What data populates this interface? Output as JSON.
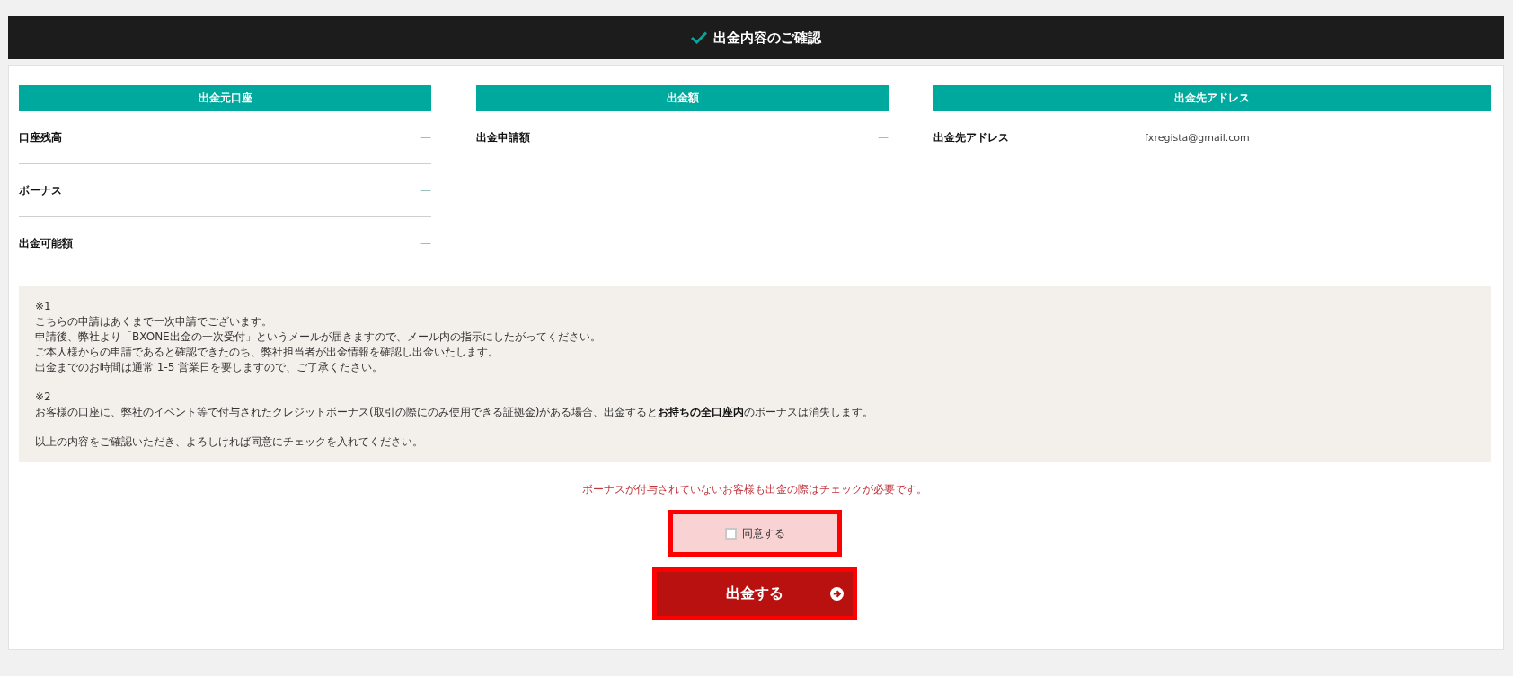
{
  "header": {
    "title": "出金内容のご確認"
  },
  "sections": [
    {
      "title": "出金元口座",
      "rows": [
        {
          "label": "口座残高",
          "value": "—",
          "kind": "dash"
        },
        {
          "label": "ボーナス",
          "value": "—",
          "kind": "dash"
        },
        {
          "label": "出金可能額",
          "value": "—",
          "kind": "dash"
        }
      ]
    },
    {
      "title": "出金額",
      "rows": [
        {
          "label": "出金申請額",
          "value": "—",
          "kind": "dash"
        }
      ]
    },
    {
      "title": "出金先アドレス",
      "rows": [
        {
          "label": "出金先アドレス",
          "value": "fxregista@gmail.com",
          "kind": "text"
        }
      ]
    }
  ],
  "notes": [
    {
      "lines": [
        "※1",
        "こちらの申請はあくまで一次申請でございます。",
        "申請後、弊社より「BXONE出金の一次受付」というメールが届きますので、メール内の指示にしたがってください。",
        "ご本人様からの申請であると確認できたのち、弊社担当者が出金情報を確認し出金いたします。",
        "出金までのお時間は通常 1-5 営業日を要しますので、ご了承ください。"
      ]
    },
    {
      "lines": [
        "※2",
        "お客様の口座に、弊社のイベント等で付与されたクレジットボーナス(取引の際にのみ使用できる証拠金)がある場合、出金すると**お持ちの全口座内**のボーナスは消失します。"
      ]
    },
    {
      "lines": [
        "以上の内容をご確認いただき、よろしければ同意にチェックを入れてください。"
      ]
    }
  ],
  "warning": "ボーナスが付与されていないお客様も出金の際はチェックが必要です。",
  "agree": {
    "label": "同意する",
    "checked": false
  },
  "submit": {
    "label": "出金する"
  }
}
